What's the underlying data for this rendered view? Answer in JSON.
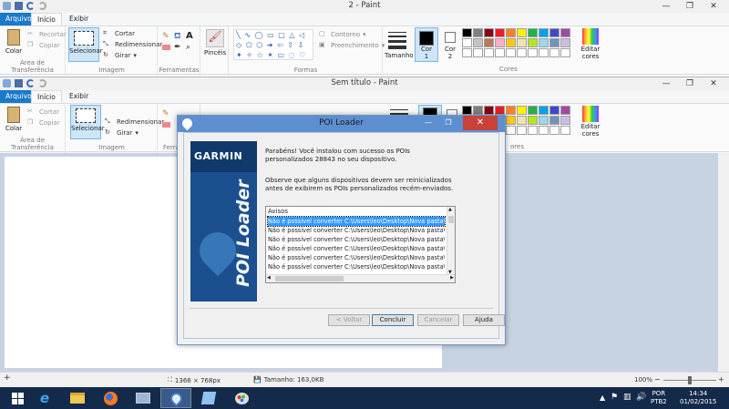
{
  "back_window": {
    "title": "2 - Paint",
    "tabs": [
      "Arquivo",
      "Início",
      "Exibir"
    ],
    "clipboard": {
      "paste": "Colar",
      "cut": "Recortar",
      "copy": "Copiar",
      "label": "Área de Transferência"
    },
    "image": {
      "select": "Selecionar",
      "crop": "Cortar",
      "resize": "Redimensionar",
      "rotate": "Girar",
      "label": "Imagem"
    },
    "tools": {
      "label": "Ferramentas"
    },
    "brushes": {
      "label": "Pincéis"
    },
    "shapes": {
      "outline": "Contorno",
      "fill": "Preenchimento",
      "label": "Formas"
    },
    "size": {
      "label": "Tamanho"
    },
    "color1": {
      "label": "Cor",
      "num": "1"
    },
    "color2": {
      "label": "Cor",
      "num": "2"
    },
    "edit_colors": {
      "line1": "Editar",
      "line2": "cores"
    },
    "colors_label": "Cores"
  },
  "front_window": {
    "title": "Sem título - Paint",
    "tabs": [
      "Arquivo",
      "Início",
      "Exibir"
    ],
    "clipboard": {
      "paste": "Colar",
      "cut": "Cortar",
      "copy": "Copiar",
      "label": "Área de Transferência"
    },
    "image": {
      "select": "Selecionar",
      "resize": "Redimensionar",
      "rotate": "Girar",
      "label": "Imagem"
    },
    "tools": {
      "label": "Ferram"
    },
    "edit_colors": {
      "line1": "Editar",
      "line2": "cores"
    },
    "colors_label": "ores"
  },
  "palette": [
    "#000000",
    "#7f7f7f",
    "#880015",
    "#ed1c24",
    "#ff7f27",
    "#fff200",
    "#22b14c",
    "#00a2e8",
    "#3f48cc",
    "#a349a4",
    "#ffffff",
    "#c3c3c3",
    "#b97a57",
    "#ffaec9",
    "#ffc90e",
    "#efe4b0",
    "#b5e61d",
    "#99d9ea",
    "#7092be",
    "#c8bfe7",
    "#ffffff",
    "#ffffff",
    "#ffffff",
    "#ffffff",
    "#ffffff",
    "#ffffff",
    "#ffffff",
    "#ffffff",
    "#ffffff",
    "#ffffff"
  ],
  "dialog": {
    "title": "POI Loader",
    "brand": "GARMIN",
    "side_text": "POI Loader",
    "message1": "Parabéns! Você instalou com sucesso os POIs personalizados 28843 no seu dispositivo.",
    "message2": "Observe que alguns dispositivos devem ser reinicializados antes de exibirem os POIs personalizados recém-enviados.",
    "list_header": "Avisos",
    "list_rows": [
      "Não é possível converter C:\\Users\\leo\\Desktop\\Nova pasta\\maparadar",
      "Não é possível converter C:\\Users\\leo\\Desktop\\Nova pasta\\maparadar",
      "Não é possível converter C:\\Users\\leo\\Desktop\\Nova pasta\\maparadar",
      "Não é possível converter C:\\Users\\leo\\Desktop\\Nova pasta\\maparadar",
      "Não é possível converter C:\\Users\\leo\\Desktop\\Nova pasta\\maparadar",
      "Não é possível converter C:\\Users\\leo\\Desktop\\Nova pasta\\maparadar"
    ],
    "buttons": {
      "back": "< Voltar",
      "finish": "Concluir",
      "cancel": "Cancelar",
      "help": "Ajuda"
    }
  },
  "statusbar": {
    "dimensions": "1366 × 768px",
    "size": "Tamanho: 163,0KB",
    "zoom": "100%"
  },
  "taskbar": {
    "lang1": "POR",
    "lang2": "PTB2",
    "time": "14:34",
    "date": "01/02/2015"
  },
  "colors": {
    "accent": "#1979ca",
    "dialog_title": "#5d8ed0",
    "close": "#c7433a",
    "taskbar": "#142a4a",
    "selection": "#3399ff"
  }
}
